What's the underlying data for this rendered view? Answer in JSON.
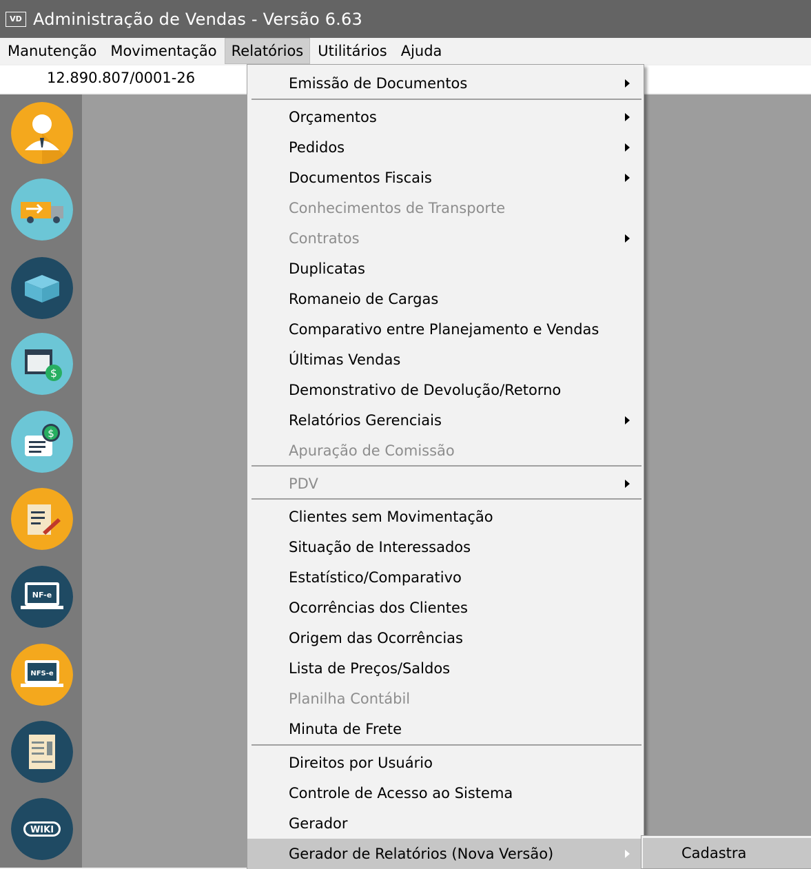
{
  "window": {
    "badge": "VD",
    "title": "Administração de Vendas - Versão 6.63"
  },
  "menubar": {
    "items": [
      "Manutenção",
      "Movimentação",
      "Relatórios",
      "Utilitários",
      "Ajuda"
    ],
    "active": "Relatórios"
  },
  "company": {
    "cnpj": "12.890.807/0001-26"
  },
  "sidebar": {
    "icons": [
      "user-icon",
      "delivery-truck-icon",
      "box-icon",
      "calendar-money-icon",
      "money-document-icon",
      "contract-signature-icon",
      "nfe-laptop-icon",
      "nfse-laptop-icon",
      "receipt-icon",
      "wiki-icon"
    ],
    "icon_texts": {
      "nfe": "NF-e",
      "nfse": "NFS-e",
      "wiki": "WIKI"
    }
  },
  "relatorios_menu": {
    "items": [
      {
        "label": "Emissão de Documentos",
        "submenu": true,
        "disabled": false
      },
      {
        "label": "Orçamentos",
        "submenu": true,
        "disabled": false
      },
      {
        "label": "Pedidos",
        "submenu": true,
        "disabled": false
      },
      {
        "label": "Documentos Fiscais",
        "submenu": true,
        "disabled": false
      },
      {
        "label": "Conhecimentos de Transporte",
        "submenu": false,
        "disabled": true
      },
      {
        "label": "Contratos",
        "submenu": true,
        "disabled": true
      },
      {
        "label": "Duplicatas",
        "submenu": false,
        "disabled": false
      },
      {
        "label": "Romaneio de Cargas",
        "submenu": false,
        "disabled": false
      },
      {
        "label": "Comparativo entre Planejamento e Vendas",
        "submenu": false,
        "disabled": false
      },
      {
        "label": "Últimas Vendas",
        "submenu": false,
        "disabled": false
      },
      {
        "label": "Demonstrativo de Devolução/Retorno",
        "submenu": false,
        "disabled": false
      },
      {
        "label": "Relatórios Gerenciais",
        "submenu": true,
        "disabled": false
      },
      {
        "label": "Apuração de Comissão",
        "submenu": false,
        "disabled": true
      },
      {
        "label": "PDV",
        "submenu": true,
        "disabled": true
      },
      {
        "label": "Clientes sem Movimentação",
        "submenu": false,
        "disabled": false
      },
      {
        "label": "Situação de Interessados",
        "submenu": false,
        "disabled": false
      },
      {
        "label": "Estatístico/Comparativo",
        "submenu": false,
        "disabled": false
      },
      {
        "label": "Ocorrências dos Clientes",
        "submenu": false,
        "disabled": false
      },
      {
        "label": "Origem das Ocorrências",
        "submenu": false,
        "disabled": false
      },
      {
        "label": "Lista de Preços/Saldos",
        "submenu": false,
        "disabled": false
      },
      {
        "label": "Planilha Contábil",
        "submenu": false,
        "disabled": true
      },
      {
        "label": "Minuta de Frete",
        "submenu": false,
        "disabled": false
      },
      {
        "label": "Direitos por Usuário",
        "submenu": false,
        "disabled": false
      },
      {
        "label": "Controle de Acesso ao Sistema",
        "submenu": false,
        "disabled": false
      },
      {
        "label": "Gerador",
        "submenu": false,
        "disabled": false
      },
      {
        "label": "Gerador de Relatórios (Nova Versão)",
        "submenu": true,
        "disabled": false,
        "highlighted": true
      }
    ]
  },
  "submenu": {
    "items": [
      "Cadastra"
    ]
  },
  "colors": {
    "titlebar": "#646464",
    "sidebar": "#7a7a7a",
    "workarea": "#9d9d9d",
    "highlight": "#c6c6c6",
    "disabled_text": "#8d8d8d"
  }
}
